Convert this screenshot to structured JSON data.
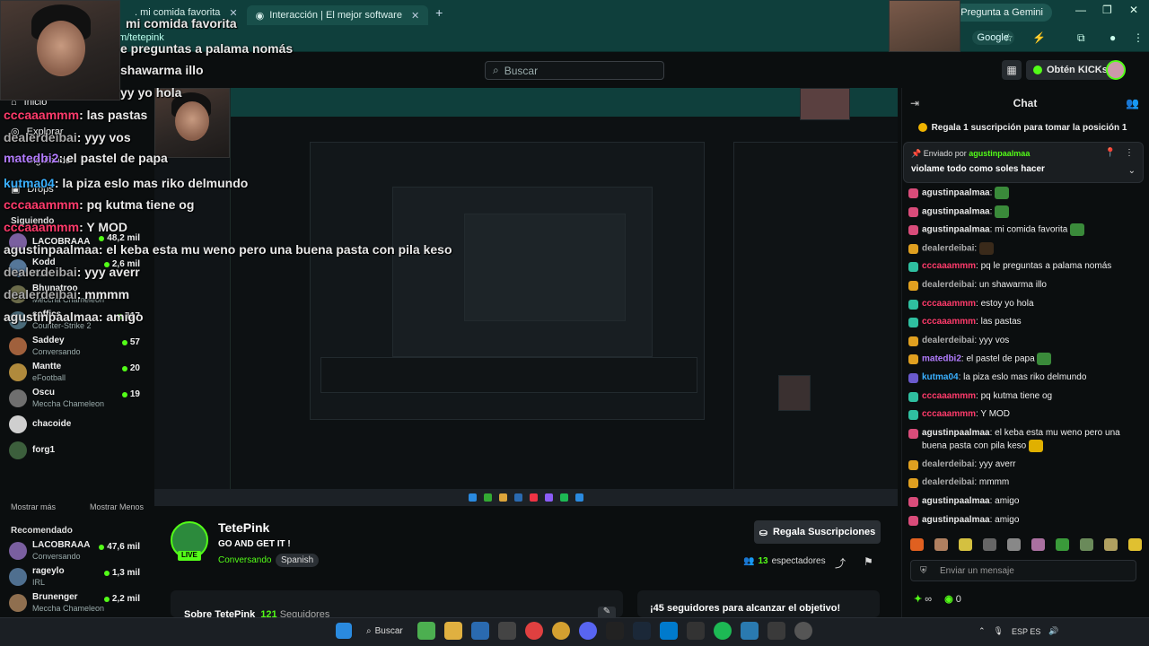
{
  "browser": {
    "tabs": [
      {
        "label": ". mi comida favorita"
      },
      {
        "label": "Interacción | El mejor software"
      }
    ],
    "new_tab": "+",
    "gemini_button": "Pregunta a Gemini",
    "url": "m/tetepink",
    "google_label": "Google"
  },
  "header": {
    "search_placeholder": "Buscar",
    "kicks_button": "Obtén KICKs"
  },
  "sidebar": {
    "nav": [
      {
        "label": "Inicio"
      },
      {
        "label": "Explorar"
      },
      {
        "label": "Siguiendo"
      },
      {
        "label": "Drops"
      }
    ],
    "following_title": "Siguiendo",
    "following": [
      {
        "name": "LACOBRAAA",
        "category": "",
        "viewers": "48,2 mil",
        "color": "#7a5fa0"
      },
      {
        "name": "Kodd",
        "category": "Rust",
        "viewers": "2,6 mil",
        "color": "#557799"
      },
      {
        "name": "Bhunatroo",
        "category": "Meccha Chameleon",
        "viewers": "",
        "color": "#6b6b4a"
      },
      {
        "name": "soffics",
        "category": "Counter-Strike 2",
        "viewers": "117",
        "color": "#4a6b7a"
      },
      {
        "name": "Saddey",
        "category": "Conversando",
        "viewers": "57",
        "color": "#a0603c"
      },
      {
        "name": "Mantte",
        "category": "eFootball",
        "viewers": "20",
        "color": "#b08a3c"
      },
      {
        "name": "Oscu",
        "category": "Meccha Chameleon",
        "viewers": "19",
        "color": "#6f6f6f"
      },
      {
        "name": "chacoide",
        "category": "",
        "viewers": "",
        "color": "#cfcfcf"
      },
      {
        "name": "forg1",
        "category": "",
        "viewers": "",
        "color": "#3c5f3c"
      }
    ],
    "show_more": "Mostrar más",
    "show_less": "Mostrar Menos",
    "recommended_title": "Recomendado",
    "recommended": [
      {
        "name": "LACOBRAAA",
        "category": "Conversando",
        "viewers": "47,6 mil",
        "color": "#7a5fa0"
      },
      {
        "name": "rageylo",
        "category": "IRL",
        "viewers": "1,3 mil",
        "color": "#4f6f8f"
      },
      {
        "name": "Brunenger",
        "category": "Meccha Chameleon",
        "viewers": "2,2 mil",
        "color": "#8f6f4f"
      }
    ]
  },
  "overlay_chat": [
    {
      "text": "mi comida favorita"
    },
    {
      "text": "e preguntas a palama nomás"
    },
    {
      "text": "shawarma illo"
    },
    {
      "text": "yy yo hola"
    },
    {
      "user": "cccaaammm",
      "text": ": las pastas",
      "color": "#ff3b6b"
    },
    {
      "user": "dealerdeibai",
      "text": ": yyy vos",
      "color": "#aaaaaa"
    },
    {
      "user": "matedbi2",
      "text": ": el pastel de papa",
      "color": "#b27cff"
    },
    {
      "user": "kutma04",
      "text": ": la piza eslo mas riko delmundo",
      "color": "#3ab0ff"
    },
    {
      "user": "cccaaammm",
      "text": ": pq kutma tiene og",
      "color": "#ff3b6b"
    },
    {
      "user": "cccaaammm",
      "text": ": Y MOD",
      "color": "#ff3b6b"
    },
    {
      "user": "agustinpaalmaa",
      "text": ": el keba esta mu weno pero una buena pasta con pila keso",
      "color": "#e0e0e0"
    },
    {
      "user": "dealerdeibai",
      "text": ": yyy averr",
      "color": "#aaaaaa"
    },
    {
      "user": "dealerdeibai",
      "text": ": mmmm",
      "color": "#aaaaaa"
    },
    {
      "user": "agustinpaalmaa",
      "text": ": amigo",
      "color": "#e0e0e0"
    }
  ],
  "stream": {
    "streamer": "TetePink",
    "title": "GO AND GET IT !",
    "category": "Conversando",
    "language": "Spanish",
    "live_badge": "LIVE",
    "subscribe_button": "Regala Suscripciones",
    "viewers": "13",
    "viewers_label": "espectadores",
    "about_title": "Sobre TetePink",
    "followers": "121",
    "followers_label": "Seguidores",
    "goal_text": "¡45 seguidores para alcanzar el objetivo!"
  },
  "chat": {
    "title": "Chat",
    "sub_banner": "Regala 1 suscripción para tomar la posición 1",
    "pinned_by_label": "Enviado por",
    "pinned_by_user": "agustinpaalmaa",
    "pinned_message": "violame todo como soles hacer",
    "messages": [
      {
        "user": "agustinpaalmaa",
        "text": ":",
        "color": "#e8e8e8",
        "badge": "#d94c7a",
        "emote": "#3a8a3a"
      },
      {
        "user": "agustinpaalmaa",
        "text": ":",
        "color": "#e8e8e8",
        "badge": "#d94c7a",
        "emote": "#3a8a3a"
      },
      {
        "user": "agustinpaalmaa",
        "text": ": mi comida favorita",
        "color": "#e8e8e8",
        "badge": "#d94c7a",
        "emote": "#3a8a3a"
      },
      {
        "user": "dealerdeibai",
        "text": ":",
        "color": "#aaaaaa",
        "badge": "#e0a020",
        "emote": "#3a2a1a"
      },
      {
        "user": "cccaaammm",
        "text": ": pq le preguntas a palama nomás",
        "color": "#ff3b6b",
        "badge": "#2fbfa0",
        "emote": ""
      },
      {
        "user": "dealerdeibai",
        "text": ": un shawarma illo",
        "color": "#aaaaaa",
        "badge": "#e0a020",
        "emote": ""
      },
      {
        "user": "cccaaammm",
        "text": ": estoy yo hola",
        "color": "#ff3b6b",
        "badge": "#2fbfa0",
        "emote": ""
      },
      {
        "user": "cccaaammm",
        "text": ": las pastas",
        "color": "#ff3b6b",
        "badge": "#2fbfa0",
        "emote": ""
      },
      {
        "user": "dealerdeibai",
        "text": ": yyy vos",
        "color": "#aaaaaa",
        "badge": "#e0a020",
        "emote": ""
      },
      {
        "user": "matedbi2",
        "text": ": el pastel de papa",
        "color": "#b27cff",
        "badge": "#e0a020",
        "emote": "#3a8a3a"
      },
      {
        "user": "kutma04",
        "text": ": la piza eslo mas riko delmundo",
        "color": "#3ab0ff",
        "badge": "#6a5acd",
        "emote": ""
      },
      {
        "user": "cccaaammm",
        "text": ": pq kutma tiene og",
        "color": "#ff3b6b",
        "badge": "#2fbfa0",
        "emote": ""
      },
      {
        "user": "cccaaammm",
        "text": ": Y MOD",
        "color": "#ff3b6b",
        "badge": "#2fbfa0",
        "emote": ""
      },
      {
        "user": "agustinpaalmaa",
        "text": ": el keba esta mu weno pero una buena pasta con pila keso",
        "color": "#e8e8e8",
        "badge": "#d94c7a",
        "emote": "#e0b000"
      },
      {
        "user": "dealerdeibai",
        "text": ": yyy averr",
        "color": "#aaaaaa",
        "badge": "#e0a020",
        "emote": ""
      },
      {
        "user": "dealerdeibai",
        "text": ": mmmm",
        "color": "#aaaaaa",
        "badge": "#e0a020",
        "emote": ""
      },
      {
        "user": "agustinpaalmaa",
        "text": ": amigo",
        "color": "#e8e8e8",
        "badge": "#d94c7a",
        "emote": ""
      },
      {
        "user": "agustinpaalmaa",
        "text": ": amigo",
        "color": "#e8e8e8",
        "badge": "#d94c7a",
        "emote": ""
      }
    ],
    "input_placeholder": "Enviar un mensaje",
    "kicks_count": "∞",
    "points": "0"
  },
  "taskbar": {
    "search_label": "Buscar",
    "language": "ESP ES"
  },
  "colors": {
    "kick_green": "#53fc18",
    "chrome_teal": "#0f3f3c"
  }
}
